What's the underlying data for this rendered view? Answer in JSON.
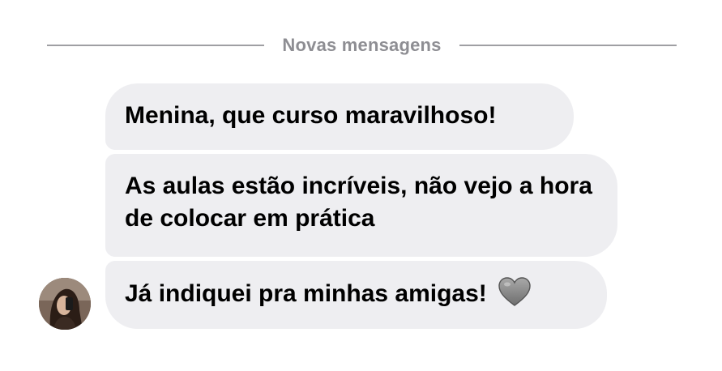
{
  "divider": {
    "label": "Novas mensagens"
  },
  "messages": [
    {
      "text": "Menina, que curso maravilhoso!"
    },
    {
      "text": "As aulas estão incríveis, não vejo a hora de colocar em prática"
    },
    {
      "text": "Já indiquei pra minhas amigas!",
      "emoji": "grey-heart"
    }
  ],
  "colors": {
    "bubble": "#eeeef1",
    "divider": "#8e8e93",
    "text": "#000000"
  }
}
